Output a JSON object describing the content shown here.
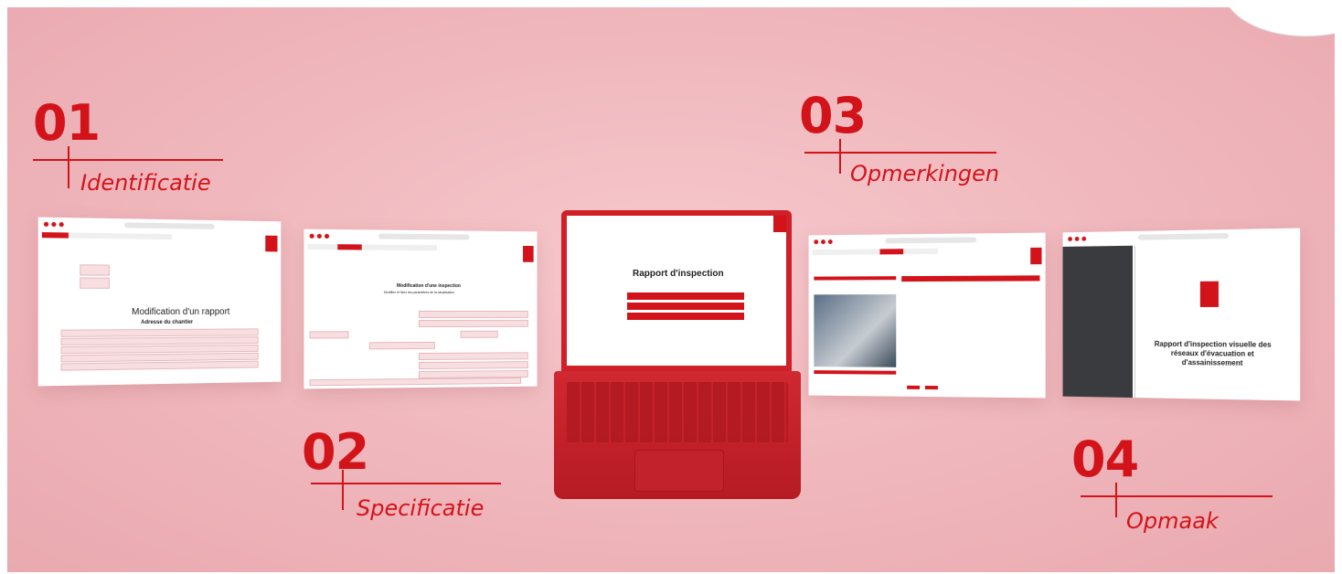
{
  "steps": [
    {
      "num": "01",
      "label": "Identificatie"
    },
    {
      "num": "02",
      "label": "Specificatie"
    },
    {
      "num": "03",
      "label": "Opmerkingen"
    },
    {
      "num": "04",
      "label": "Opmaak"
    }
  ],
  "window1": {
    "title": "Modification d'un rapport",
    "subtitle": "Adresse du chantier"
  },
  "window2": {
    "title": "Modification d'une inspection",
    "subtitle": "Modifiez et fixez les paramètres de la canalisation"
  },
  "laptop": {
    "title": "Rapport d'inspection"
  },
  "window4": {
    "doc_title": "Rapport d'inspection visuelle des réseaux d'évacuation et d'assainissement"
  },
  "colors": {
    "brand_red": "#d3131a",
    "background_pink": "#f2bcc0"
  }
}
